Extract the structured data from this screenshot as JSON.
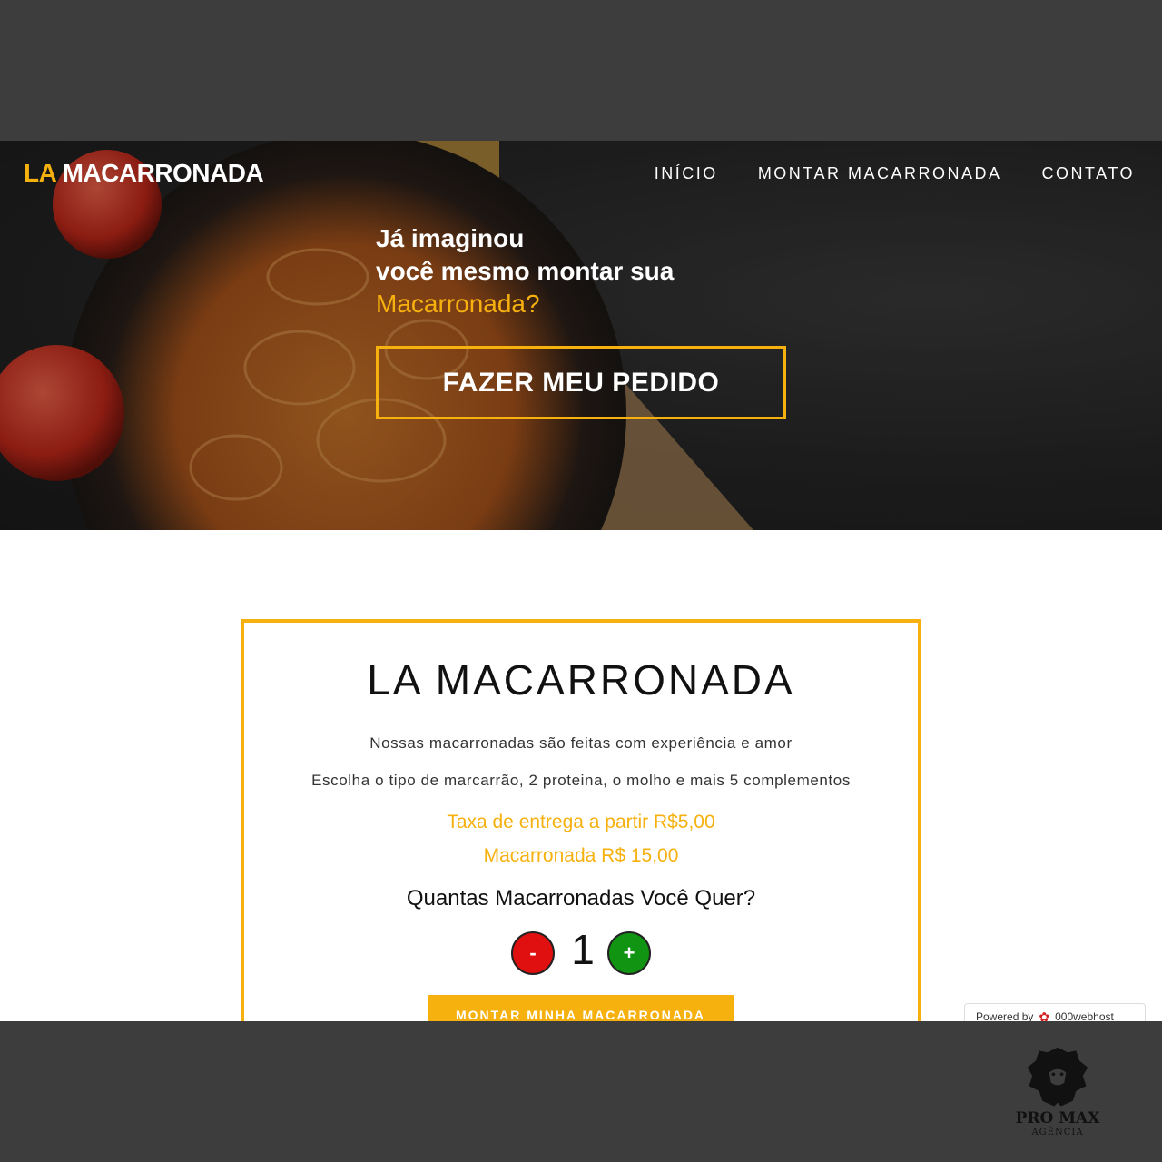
{
  "header": {
    "brand_accent": "LA",
    "brand_rest": "MACARRONADA",
    "nav": [
      {
        "label": "INÍCIO"
      },
      {
        "label": "MONTAR MACARRONADA"
      },
      {
        "label": "CONTATO"
      }
    ]
  },
  "hero": {
    "line1": "Já imaginou",
    "line2": "você mesmo montar sua",
    "accent": "Macarronada?",
    "cta_label": "FAZER MEU PEDIDO"
  },
  "card": {
    "title": "LA MACARRONADA",
    "desc1": "Nossas macarronadas são feitas com experiência e amor",
    "desc2": "Escolha o tipo de marcarrão, 2 proteina, o molho e mais 5 complementos",
    "delivery": "Taxa de entrega a partir R$5,00",
    "price": "Macarronada R$ 15,00",
    "question": "Quantas Macarronadas Você Quer?",
    "minus_label": "-",
    "quantity": "1",
    "plus_label": "+",
    "submit_label": "MONTAR MINHA MACARRONADA"
  },
  "badge": {
    "prefix": "Powered by",
    "host": "000webhost"
  },
  "agency": {
    "name": "PRO MAX",
    "sub": "AGÊNCIA"
  },
  "colors": {
    "accent": "#f6b10f",
    "minus": "#e01010",
    "plus": "#119411",
    "frame": "#3d3d3d"
  }
}
